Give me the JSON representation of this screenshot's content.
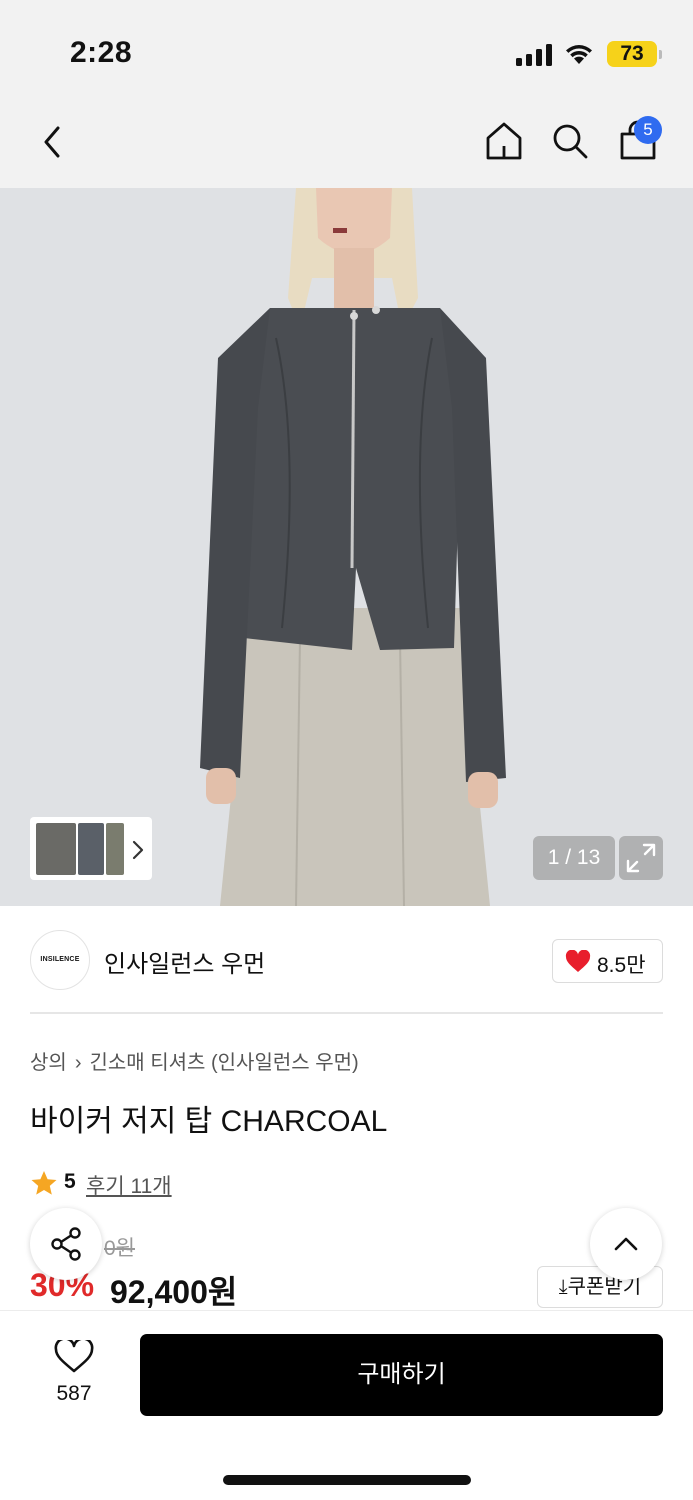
{
  "status_bar": {
    "time": "2:28",
    "battery": "73",
    "battery_color": "#f6d21a"
  },
  "nav": {
    "back_icon": "chevron-left-icon",
    "home_icon": "home-icon",
    "search_icon": "search-icon",
    "cart_icon": "shopping-bag-icon",
    "cart_count": "5",
    "cart_badge_color": "#2f6bf0"
  },
  "gallery": {
    "counter": "1 / 13",
    "expand_icon": "expand-icon"
  },
  "brand": {
    "logo_text": "INSILENCE",
    "name": "인사일런스 우먼",
    "likes": "8.5만"
  },
  "product": {
    "breadcrumb": [
      "상의",
      "긴소매 티셔츠 (인사일런스 우먼)"
    ],
    "title": "바이커 저지 탑 CHARCOAL",
    "rating": "5",
    "reviews": "후기 11개",
    "original_price": "0원",
    "discount": "30%",
    "price": "92,400원",
    "coupon_label": "쿠폰받기"
  },
  "bottom_bar": {
    "wish_count": "587",
    "buy_label": "구매하기"
  },
  "colors": {
    "discount": "#e02a2a",
    "heart": "#e81e2c",
    "star": "#f5a623"
  }
}
